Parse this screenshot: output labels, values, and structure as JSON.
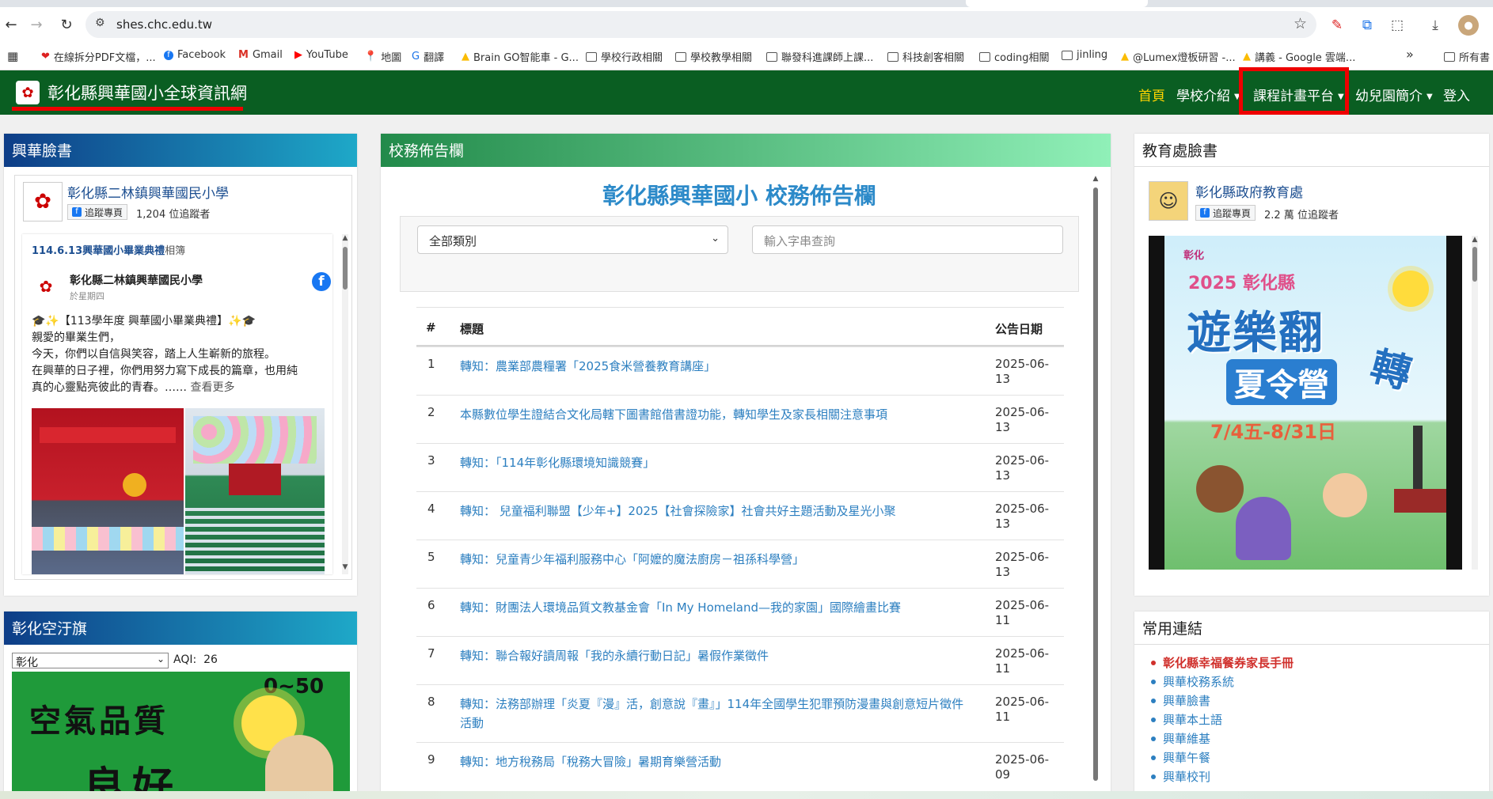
{
  "browser": {
    "url": "shes.chc.edu.tw",
    "bookmarks": [
      "在線拆分PDF文檔，...",
      "Facebook",
      "Gmail",
      "YouTube",
      "地圖",
      "翻譯",
      "Brain GO智能車 - G...",
      "學校行政相關",
      "學校教學相關",
      "聯發科進課師上課...",
      "科技創客相關",
      "coding相關",
      "jinling",
      "@Lumex燈板研習 -...",
      "講義 - Google 雲端...",
      "所有書"
    ],
    "more": "»"
  },
  "site": {
    "brand": "彰化縣興華國小全球資訊網",
    "nav": [
      "首頁",
      "學校介紹",
      "課程計畫平台",
      "幼兒園簡介",
      "登入"
    ]
  },
  "fb_left": {
    "header": "興華臉書",
    "page_name": "彰化縣二林鎮興華國民小學",
    "follow_label": "追蹤專頁",
    "followers": "1,204 位追蹤者",
    "post_link": "114.6.13興華國小畢業典禮",
    "post_link_suffix": "相簿",
    "author": "彰化縣二林鎮興華國民小學",
    "time": "於星期四",
    "lines": [
      "🎓✨【113學年度 興華國小畢業典禮】✨🎓",
      "親愛的畢業生們，",
      "今天，你們以自信與笑容，踏上人生嶄新的旅程。",
      "在興華的日子裡，你們用努力寫下成長的篇章，也用純",
      "真的心靈點亮彼此的青春。……"
    ],
    "see_more": "查看更多"
  },
  "announce": {
    "header": "校務佈告欄",
    "title": "彰化縣興華國小 校務佈告欄",
    "category": "全部類別",
    "search_placeholder": "輸入字串查詢",
    "col_num": "#",
    "col_title": "標題",
    "col_date": "公告日期",
    "rows": [
      {
        "num": "1",
        "title": "轉知：農業部農糧署「2025食米營養教育講座」",
        "date": "2025-06-13"
      },
      {
        "num": "2",
        "title": "本縣數位學生證結合文化局轄下圖書館借書證功能，轉知學生及家長相關注意事項",
        "date": "2025-06-13"
      },
      {
        "num": "3",
        "title": "轉知：「114年彰化縣環境知識競賽」",
        "date": "2025-06-13"
      },
      {
        "num": "4",
        "title": "轉知： 兒童福利聯盟【少年+】2025【社會探險家】社會共好主題活動及星光小聚",
        "date": "2025-06-13"
      },
      {
        "num": "5",
        "title": "轉知：兒童青少年福利服務中心「阿嬤的魔法廚房－祖孫科學營」",
        "date": "2025-06-13"
      },
      {
        "num": "6",
        "title": "轉知：財團法人環境品質文教基金會「In My Homeland—我的家園」國際繪畫比賽",
        "date": "2025-06-11"
      },
      {
        "num": "7",
        "title": "轉知：聯合報好讀周報「我的永續行動日記」暑假作業徵件",
        "date": "2025-06-11"
      },
      {
        "num": "8",
        "title": "轉知：法務部辦理「炎夏『漫』活，創意說『畫』」114年全國學生犯罪預防漫畫與創意短片徵件活動",
        "date": "2025-06-11"
      },
      {
        "num": "9",
        "title": "轉知：地方稅務局「稅務大冒險」暑期育樂營活動",
        "date": "2025-06-09"
      }
    ]
  },
  "fb_right": {
    "header": "教育處臉書",
    "page_name": "彰化縣政府教育處",
    "follow_label": "追蹤專頁",
    "followers": "2.2 萬 位追蹤者",
    "poster": {
      "badge": "彰化",
      "year": "2025",
      "county": "彰化縣",
      "line1": "遊樂翻",
      "line2": "轉",
      "line3": "夏令營",
      "dates": "7/4五-8/31日"
    }
  },
  "aqi": {
    "header": "彰化空汙旗",
    "location": "彰化",
    "label": "AQI:",
    "value": "26",
    "range": "0~50",
    "line1": "空氣品質",
    "line2": "良好"
  },
  "links": {
    "header": "常用連結",
    "items": [
      "彰化縣幸福餐券家長手冊",
      "興華校務系統",
      "興華臉書",
      "興華本土語",
      "興華維基",
      "興華午餐",
      "興華校刊"
    ]
  },
  "colors": {
    "nav_bg": "#0a5e22",
    "active_nav": "#ffd400",
    "link": "#2c7fc0",
    "highlight": "#e00000"
  }
}
